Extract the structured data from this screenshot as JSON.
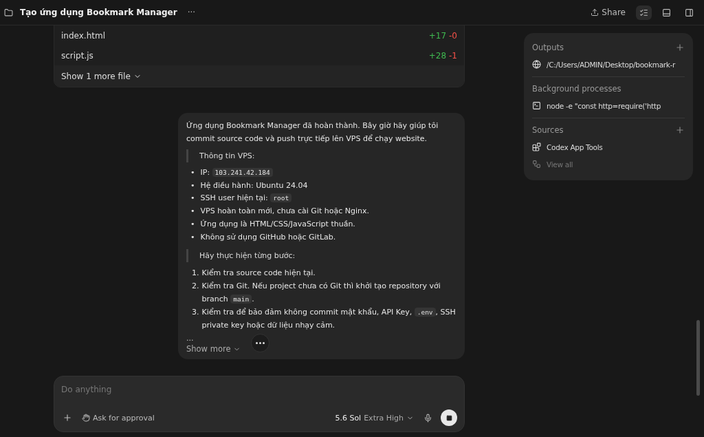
{
  "header": {
    "title": "Tạo ứng dụng Bookmark Manager",
    "more": "···",
    "share": "Share"
  },
  "files": {
    "rows": [
      {
        "name": "index.html",
        "added": "+17",
        "removed": "-0"
      },
      {
        "name": "script.js",
        "added": "+28",
        "removed": "-1"
      }
    ],
    "show_more": "Show 1 more file"
  },
  "message": {
    "intro": "Ứng dụng Bookmark Manager đã hoàn thành. Bây giờ hãy giúp tôi commit source code và push trực tiếp lên VPS để chạy website.",
    "quote1": "Thông tin VPS:",
    "bullets": [
      {
        "marker": "•",
        "parts": [
          {
            "text": "IP: "
          },
          {
            "code": "103.241.42.184"
          }
        ]
      },
      {
        "marker": "•",
        "parts": [
          {
            "text": "Hệ điều hành: Ubuntu 24.04"
          }
        ]
      },
      {
        "marker": "•",
        "parts": [
          {
            "text": "SSH user hiện tại: "
          },
          {
            "code": "root"
          }
        ]
      },
      {
        "marker": "•",
        "parts": [
          {
            "text": "VPS hoàn toàn mới, chưa cài Git hoặc Nginx."
          }
        ]
      },
      {
        "marker": "•",
        "parts": [
          {
            "text": "Ứng dụng là HTML/CSS/JavaScript thuần."
          }
        ]
      },
      {
        "marker": "•",
        "parts": [
          {
            "text": "Không sử dụng GitHub hoặc GitLab."
          }
        ]
      }
    ],
    "quote2": "Hãy thực hiện từng bước:",
    "steps": [
      {
        "number": "1.",
        "parts": [
          {
            "text": "Kiểm tra source code hiện tại."
          }
        ]
      },
      {
        "number": "2.",
        "parts": [
          {
            "text": "Kiểm tra Git. Nếu project chưa có Git thì khởi tạo repository với branch "
          },
          {
            "code": "main"
          },
          {
            "text": "."
          }
        ]
      },
      {
        "number": "3.",
        "parts": [
          {
            "text": "Kiểm tra để bảo đảm không commit mật khẩu, API Key, "
          },
          {
            "code": ".env"
          },
          {
            "text": ", SSH private key hoặc dữ liệu nhạy cảm."
          }
        ]
      }
    ],
    "ellipsis": "...",
    "show_more": "Show more"
  },
  "composer": {
    "placeholder": "Do anything",
    "approval": "Ask for approval",
    "model": "5.6 Sol",
    "effort": "Extra High"
  },
  "panel": {
    "sections": [
      {
        "title": "Outputs",
        "addable": true,
        "items": [
          {
            "kind": "globe",
            "label": "/C:/Users/ADMIN/Desktop/bookmark-r",
            "dim": false
          }
        ]
      },
      {
        "title": "Background processes",
        "addable": false,
        "items": [
          {
            "kind": "terminal",
            "label": "node -e \"const http=require('http",
            "dim": false
          }
        ]
      },
      {
        "title": "Sources",
        "addable": true,
        "items": [
          {
            "kind": "tools",
            "label": "Codex App Tools",
            "dim": false
          },
          {
            "kind": "link",
            "label": "View all",
            "dim": true
          }
        ]
      }
    ]
  }
}
